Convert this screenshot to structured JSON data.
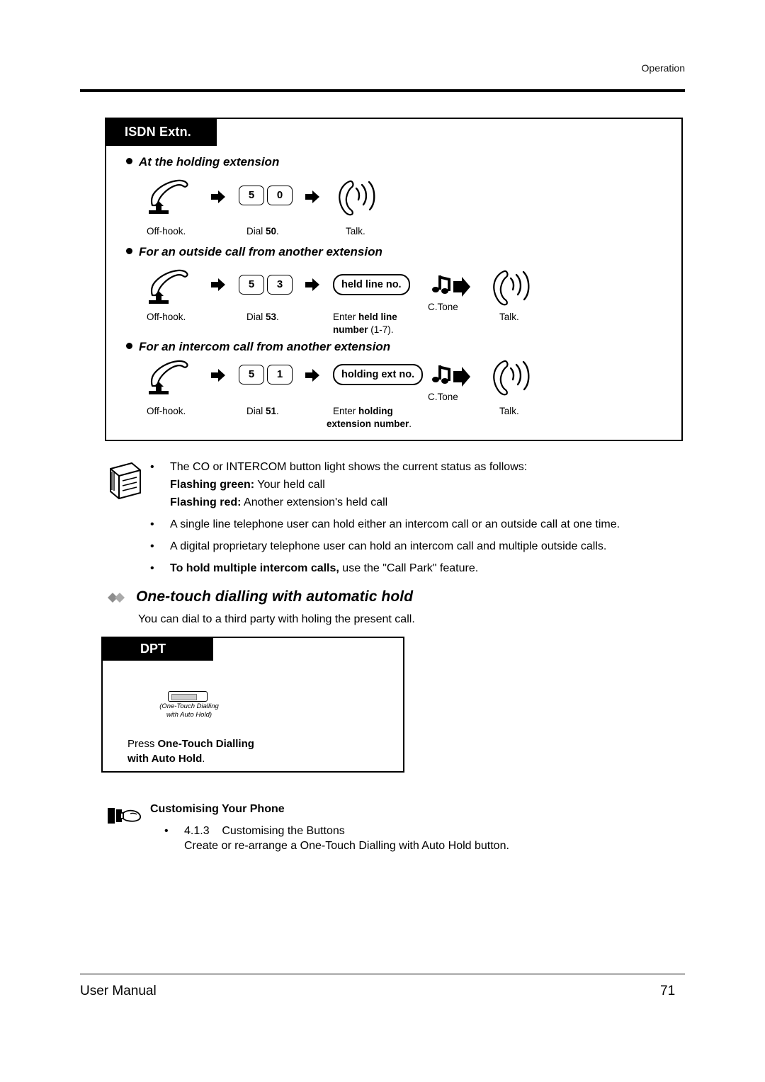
{
  "header": {
    "section": "Operation"
  },
  "isdn": {
    "tag": "ISDN Extn.",
    "sections": [
      {
        "title": "At the holding extension",
        "captions": {
          "offhook": "Off-hook.",
          "dial_pre": "Dial ",
          "dial_num": "50",
          "dial_post": ".",
          "talk": "Talk."
        },
        "keys": [
          "5",
          "0"
        ]
      },
      {
        "title": "For an outside call from another extension",
        "captions": {
          "offhook": "Off-hook.",
          "dial_pre": "Dial ",
          "dial_num": "53",
          "dial_post": ".",
          "enter_pre": "Enter ",
          "enter_bold": "held line",
          "enter_bold2": "number",
          "enter_post": " (1-7).",
          "tone": "C.Tone",
          "talk": "Talk."
        },
        "keys": [
          "5",
          "3"
        ],
        "softkey": "held line no."
      },
      {
        "title": "For an intercom call from another extension",
        "captions": {
          "offhook": "Off-hook.",
          "dial_pre": "Dial ",
          "dial_num": "51",
          "dial_post": ".",
          "enter_pre": "Enter ",
          "enter_bold": "holding",
          "enter_bold2": "extension number",
          "enter_post": ".",
          "tone": "C.Tone",
          "talk": "Talk."
        },
        "keys": [
          "5",
          "1"
        ],
        "softkey": "holding ext no."
      }
    ]
  },
  "notes": [
    {
      "lines": [
        {
          "text": "The CO or INTERCOM button light shows the current status as follows:",
          "bold_prefix": ""
        },
        {
          "bold_prefix": "Flashing green:",
          "text": " Your held call"
        },
        {
          "bold_prefix": "Flashing red:",
          "text": " Another extension's held call"
        }
      ]
    },
    {
      "lines": [
        {
          "bold_prefix": "",
          "text": "A single line telephone user can hold either an intercom call or an outside call at one time."
        }
      ]
    },
    {
      "lines": [
        {
          "bold_prefix": "",
          "text": "A digital proprietary telephone user can hold an intercom call and multiple outside calls."
        }
      ]
    },
    {
      "lines": [
        {
          "bold_prefix": "To hold multiple intercom calls,",
          "text": " use the \"Call Park\" feature."
        }
      ]
    }
  ],
  "feature": {
    "heading": "One-touch dialling with automatic hold",
    "lead": "You can dial to a third party with holing the present call.",
    "dpt_tag": "DPT",
    "button_label_line1": "(One-Touch Dialling",
    "button_label_line2": "with Auto Hold)",
    "caption_pre": "Press ",
    "caption_bold1": "One-Touch Dialling",
    "caption_bold2": "with Auto Hold",
    "caption_post": "."
  },
  "customising": {
    "title": "Customising Your Phone",
    "item_number": "4.1.3",
    "item_label": "Customising the Buttons",
    "item_desc": "Create or re-arrange a One-Touch Dialling with Auto Hold button."
  },
  "footer": {
    "left": "User Manual",
    "page": "71"
  }
}
